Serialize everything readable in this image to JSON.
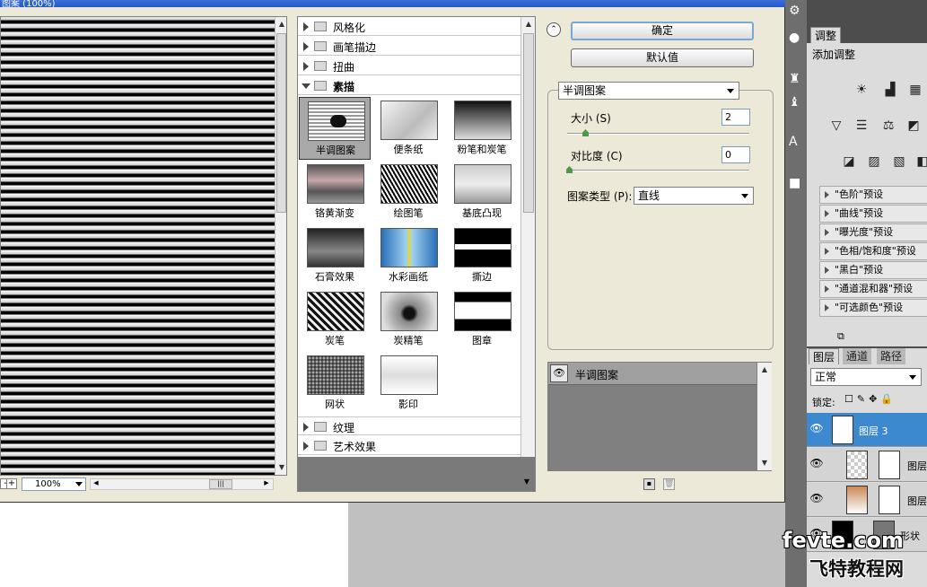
{
  "window": {
    "title": "图案 (100%)"
  },
  "preview": {
    "zoom": "100%"
  },
  "categories": [
    {
      "label": "风格化",
      "expanded": false
    },
    {
      "label": "画笔描边",
      "expanded": false
    },
    {
      "label": "扭曲",
      "expanded": false
    },
    {
      "label": "素描",
      "expanded": true
    },
    {
      "label": "纹理",
      "expanded": false
    },
    {
      "label": "艺术效果",
      "expanded": false
    }
  ],
  "sketch_filters": [
    {
      "label": "半调图案",
      "selected": true
    },
    {
      "label": "便条纸"
    },
    {
      "label": "粉笔和炭笔"
    },
    {
      "label": "铬黄渐变"
    },
    {
      "label": "绘图笔"
    },
    {
      "label": "基底凸现"
    },
    {
      "label": "石膏效果"
    },
    {
      "label": "水彩画纸"
    },
    {
      "label": "撕边"
    },
    {
      "label": "炭笔"
    },
    {
      "label": "炭精笔"
    },
    {
      "label": "图章"
    },
    {
      "label": "网状"
    },
    {
      "label": "影印"
    }
  ],
  "buttons": {
    "ok": "确定",
    "default": "默认值"
  },
  "settings": {
    "filter_select": "半调图案",
    "size_label": "大小 (S)",
    "size_value": "2",
    "contrast_label": "对比度 (C)",
    "contrast_value": "0",
    "pattern_type_label": "图案类型 (P):",
    "pattern_type_value": "直线"
  },
  "effect_layers": [
    {
      "label": "半调图案"
    }
  ],
  "ps_panel": {
    "tabs_top": [
      "调整"
    ],
    "adj_title": "添加调整",
    "presets": [
      "\"色阶\"预设",
      "\"曲线\"预设",
      "\"曝光度\"预设",
      "\"色相/饱和度\"预设",
      "\"黑白\"预设",
      "\"通道混和器\"预设",
      "\"可选颜色\"预设"
    ],
    "layer_tabs": [
      "图层",
      "通道",
      "路径"
    ],
    "blend_mode": "正常",
    "lock_label": "锁定:",
    "layers": [
      "图层 3",
      "图层",
      "图层",
      "形状"
    ]
  },
  "watermark": {
    "line1": "fevte.com",
    "line2": "飞特教程网"
  },
  "colors": {
    "selected_layer": "#3c89d0",
    "titlebar": "#2457c8"
  }
}
